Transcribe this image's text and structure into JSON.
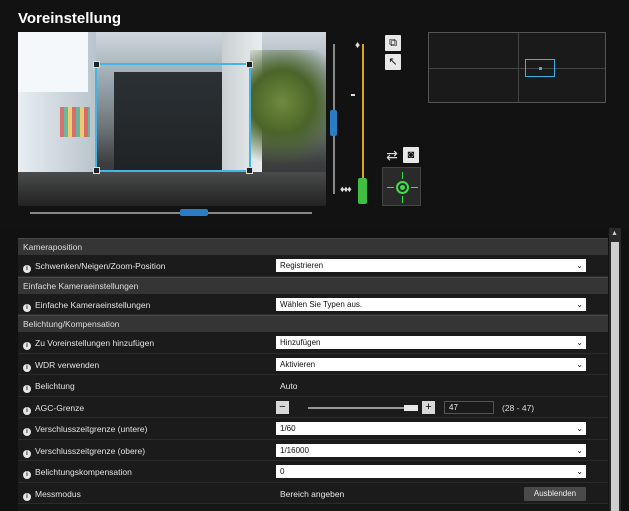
{
  "page": {
    "title": "Voreinstellung"
  },
  "camera": {
    "zoom_tele_icon": "tele-person-icon",
    "zoom_wide_icon": "wide-people-icon",
    "tele_glyph": "♦",
    "wide_glyph": "♦♦♦"
  },
  "toolbar": {
    "fit_icon": "fit-window-icon",
    "fit_glyph": "⧉",
    "pointer_icon": "pointer-icon",
    "pointer_glyph": "↖",
    "swap_icon": "swap-arrows-icon",
    "swap_glyph": "⇄",
    "snapshot_icon": "camera-icon",
    "snapshot_glyph": "◙",
    "ptz_icon": "crosshair-icon"
  },
  "settings": {
    "sections": {
      "camera_position": "Kameraposition",
      "simple": "Einfache Kameraeinstellungen",
      "exposure": "Belichtung/Kompensation"
    },
    "rows": {
      "ptz_position": {
        "label": "Schwenken/Neigen/Zoom-Position",
        "value": "Registrieren"
      },
      "simple_settings": {
        "label": "Einfache Kameraeinstellungen",
        "value": "Wählen Sie Typen aus."
      },
      "add_to_presets": {
        "label": "Zu Voreinstellungen hinzufügen",
        "value": "Hinzufügen"
      },
      "use_wdr": {
        "label": "WDR verwenden",
        "value": "Aktivieren"
      },
      "exposure": {
        "label": "Belichtung",
        "value": "Auto"
      },
      "agc_limit": {
        "label": "AGC-Grenze",
        "value": "47",
        "range": "(28 - 47)",
        "minus": "−",
        "plus": "+",
        "level": 1.0
      },
      "shutter_lower": {
        "label": "Verschlusszeitgrenze (untere)",
        "value": "1/60"
      },
      "shutter_upper": {
        "label": "Verschlusszeitgrenze (obere)",
        "value": "1/16000"
      },
      "exposure_comp": {
        "label": "Belichtungskompensation",
        "value": "0"
      },
      "metering": {
        "label": "Messmodus",
        "value": "Bereich angeben",
        "button": "Ausblenden"
      }
    },
    "info_glyph": "i",
    "chevron_glyph": "⌄",
    "scroll_up_glyph": "▲"
  },
  "colors": {
    "frame": "#45b5e6",
    "pan_tilt_thumb": "#2a7dc4",
    "zoom_track": "#e0a020",
    "zoom_thumb": "#3fbf3f",
    "ptz_center": "#3ee04a"
  }
}
